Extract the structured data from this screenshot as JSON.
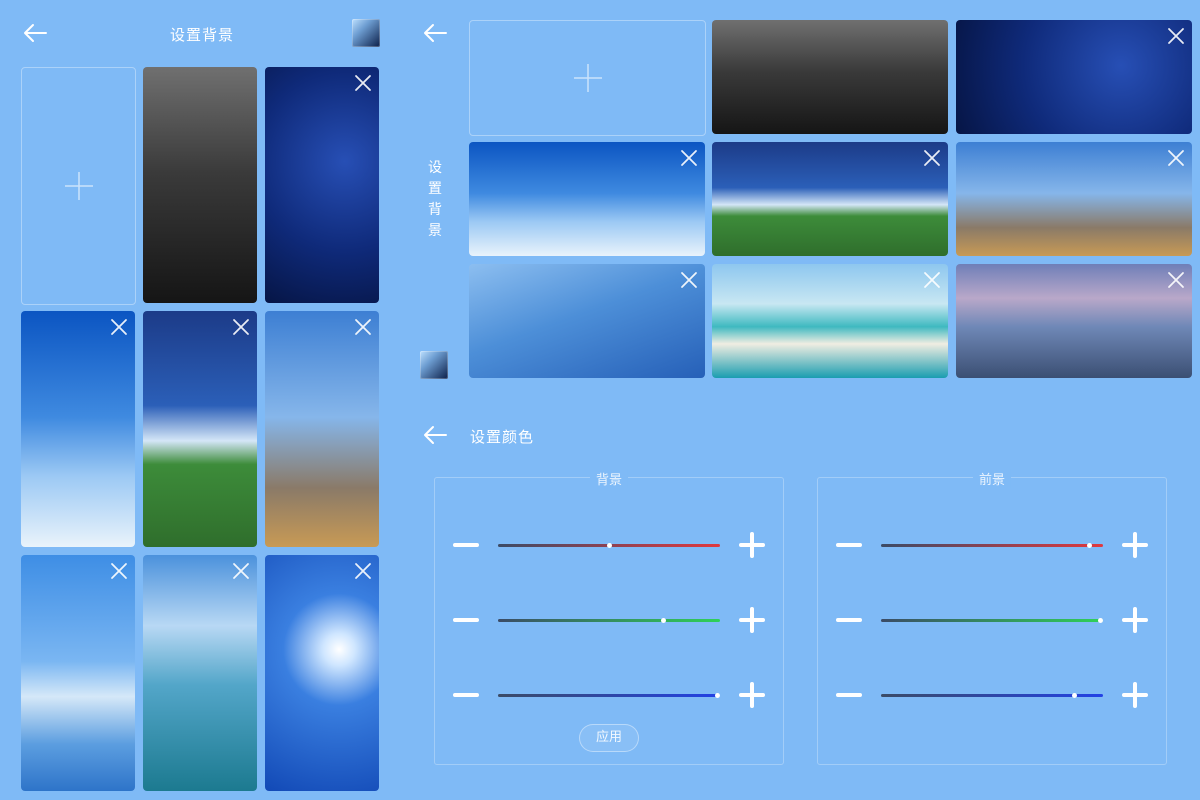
{
  "left_screen": {
    "title": "设置背景",
    "tiles": [
      {
        "name": "wallpaper-cd",
        "style": "wp-cd",
        "closable": false
      },
      {
        "name": "wallpaper-night-sea",
        "style": "wp-night",
        "closable": true
      },
      {
        "name": "wallpaper-airplane",
        "style": "wp-plane",
        "closable": true
      },
      {
        "name": "wallpaper-stadium",
        "style": "wp-stadium",
        "closable": true
      },
      {
        "name": "wallpaper-skyscraper",
        "style": "wp-city",
        "closable": true
      },
      {
        "name": "wallpaper-cloud-reflection",
        "style": "wp-sky",
        "closable": true
      },
      {
        "name": "wallpaper-sun-over-sea",
        "style": "wp-sea",
        "closable": true
      },
      {
        "name": "wallpaper-sunburst-sky",
        "style": "wp-sun",
        "closable": true
      }
    ]
  },
  "right_top": {
    "title": "设置背景",
    "tiles": [
      {
        "name": "wallpaper-cd",
        "style": "wp-cd",
        "closable": false
      },
      {
        "name": "wallpaper-night-sea",
        "style": "wp-night",
        "closable": true
      },
      {
        "name": "wallpaper-airplane",
        "style": "wp-plane",
        "closable": true
      },
      {
        "name": "wallpaper-stadium",
        "style": "wp-stadium",
        "closable": true
      },
      {
        "name": "wallpaper-skyscraper",
        "style": "wp-city",
        "closable": true
      },
      {
        "name": "wallpaper-glass-tower",
        "style": "wp-tower",
        "closable": true
      },
      {
        "name": "wallpaper-beach-pool",
        "style": "wp-beach",
        "closable": true
      },
      {
        "name": "wallpaper-resort-pool",
        "style": "wp-resort",
        "closable": true
      }
    ]
  },
  "color_settings": {
    "title": "设置颜色",
    "apply_label": "应用",
    "panels": [
      {
        "label": "背景",
        "key": "background",
        "sliders": [
          {
            "channel": "red",
            "color": "#e0393f",
            "value": 0.5
          },
          {
            "channel": "green",
            "color": "#2fd158",
            "value": 0.75
          },
          {
            "channel": "blue",
            "color": "#2342e6",
            "value": 1.0
          }
        ]
      },
      {
        "label": "前景",
        "key": "foreground",
        "sliders": [
          {
            "channel": "red",
            "color": "#e0393f",
            "value": 0.95
          },
          {
            "channel": "green",
            "color": "#2fd158",
            "value": 1.0
          },
          {
            "channel": "blue",
            "color": "#2342e6",
            "value": 0.88
          }
        ]
      }
    ]
  },
  "colors": {
    "page_background": "#7fbaf6",
    "track_dark": "#3b4b66"
  }
}
